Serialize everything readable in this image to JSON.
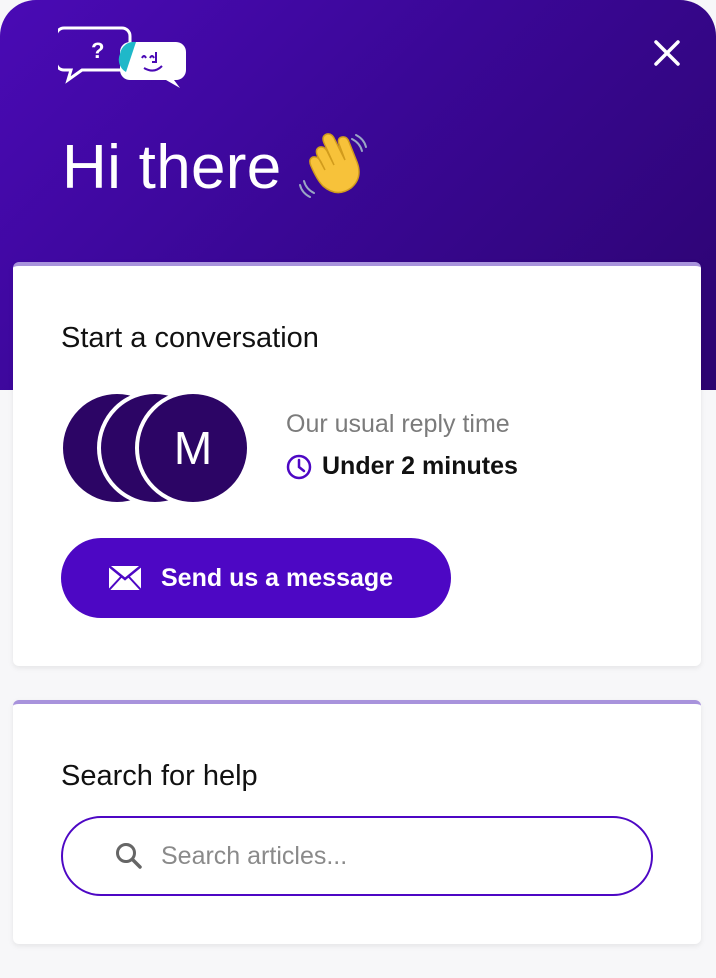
{
  "header": {
    "greeting": "Hi there",
    "logo_icon": "chat-bubbles-logo-icon",
    "wave_icon": "waving-hand-icon",
    "close_icon": "close-icon",
    "colors": {
      "gradient_start": "#4a0ab5",
      "gradient_end": "#2c0470"
    }
  },
  "conversation": {
    "title": "Start a conversation",
    "avatars": [
      "",
      "",
      "M"
    ],
    "reply_label": "Our usual reply time",
    "reply_time": "Under 2 minutes",
    "send_button_label": "Send us a message",
    "accent_color": "#4d07c4"
  },
  "search": {
    "title": "Search for help",
    "placeholder": "Search articles..."
  }
}
